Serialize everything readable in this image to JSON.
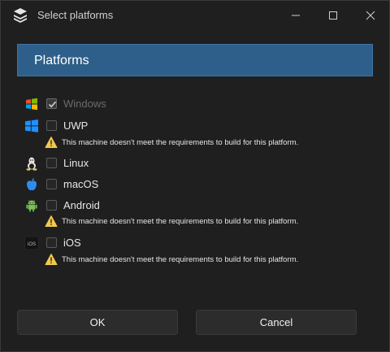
{
  "window": {
    "title": "Select platforms"
  },
  "header": {
    "title": "Platforms"
  },
  "platforms": [
    {
      "name": "Windows",
      "checked": true,
      "enabled": false,
      "icon": "windows-icon"
    },
    {
      "name": "UWP",
      "checked": false,
      "enabled": true,
      "icon": "uwp-icon",
      "warning": "This machine doesn't meet the requirements to build for this platform."
    },
    {
      "name": "Linux",
      "checked": false,
      "enabled": true,
      "icon": "linux-icon"
    },
    {
      "name": "macOS",
      "checked": false,
      "enabled": true,
      "icon": "apple-icon"
    },
    {
      "name": "Android",
      "checked": false,
      "enabled": true,
      "icon": "android-icon",
      "warning": "This machine doesn't meet the requirements to build for this platform."
    },
    {
      "name": "iOS",
      "checked": false,
      "enabled": true,
      "icon": "ios-icon",
      "icon_text": "iOS",
      "warning": "This machine doesn't meet the requirements to build for this platform."
    }
  ],
  "buttons": {
    "ok": "OK",
    "cancel": "Cancel"
  },
  "colors": {
    "header_bg": "#2d5f8a",
    "window_bg": "#1f1f1f",
    "warning": "#f2c94c"
  }
}
